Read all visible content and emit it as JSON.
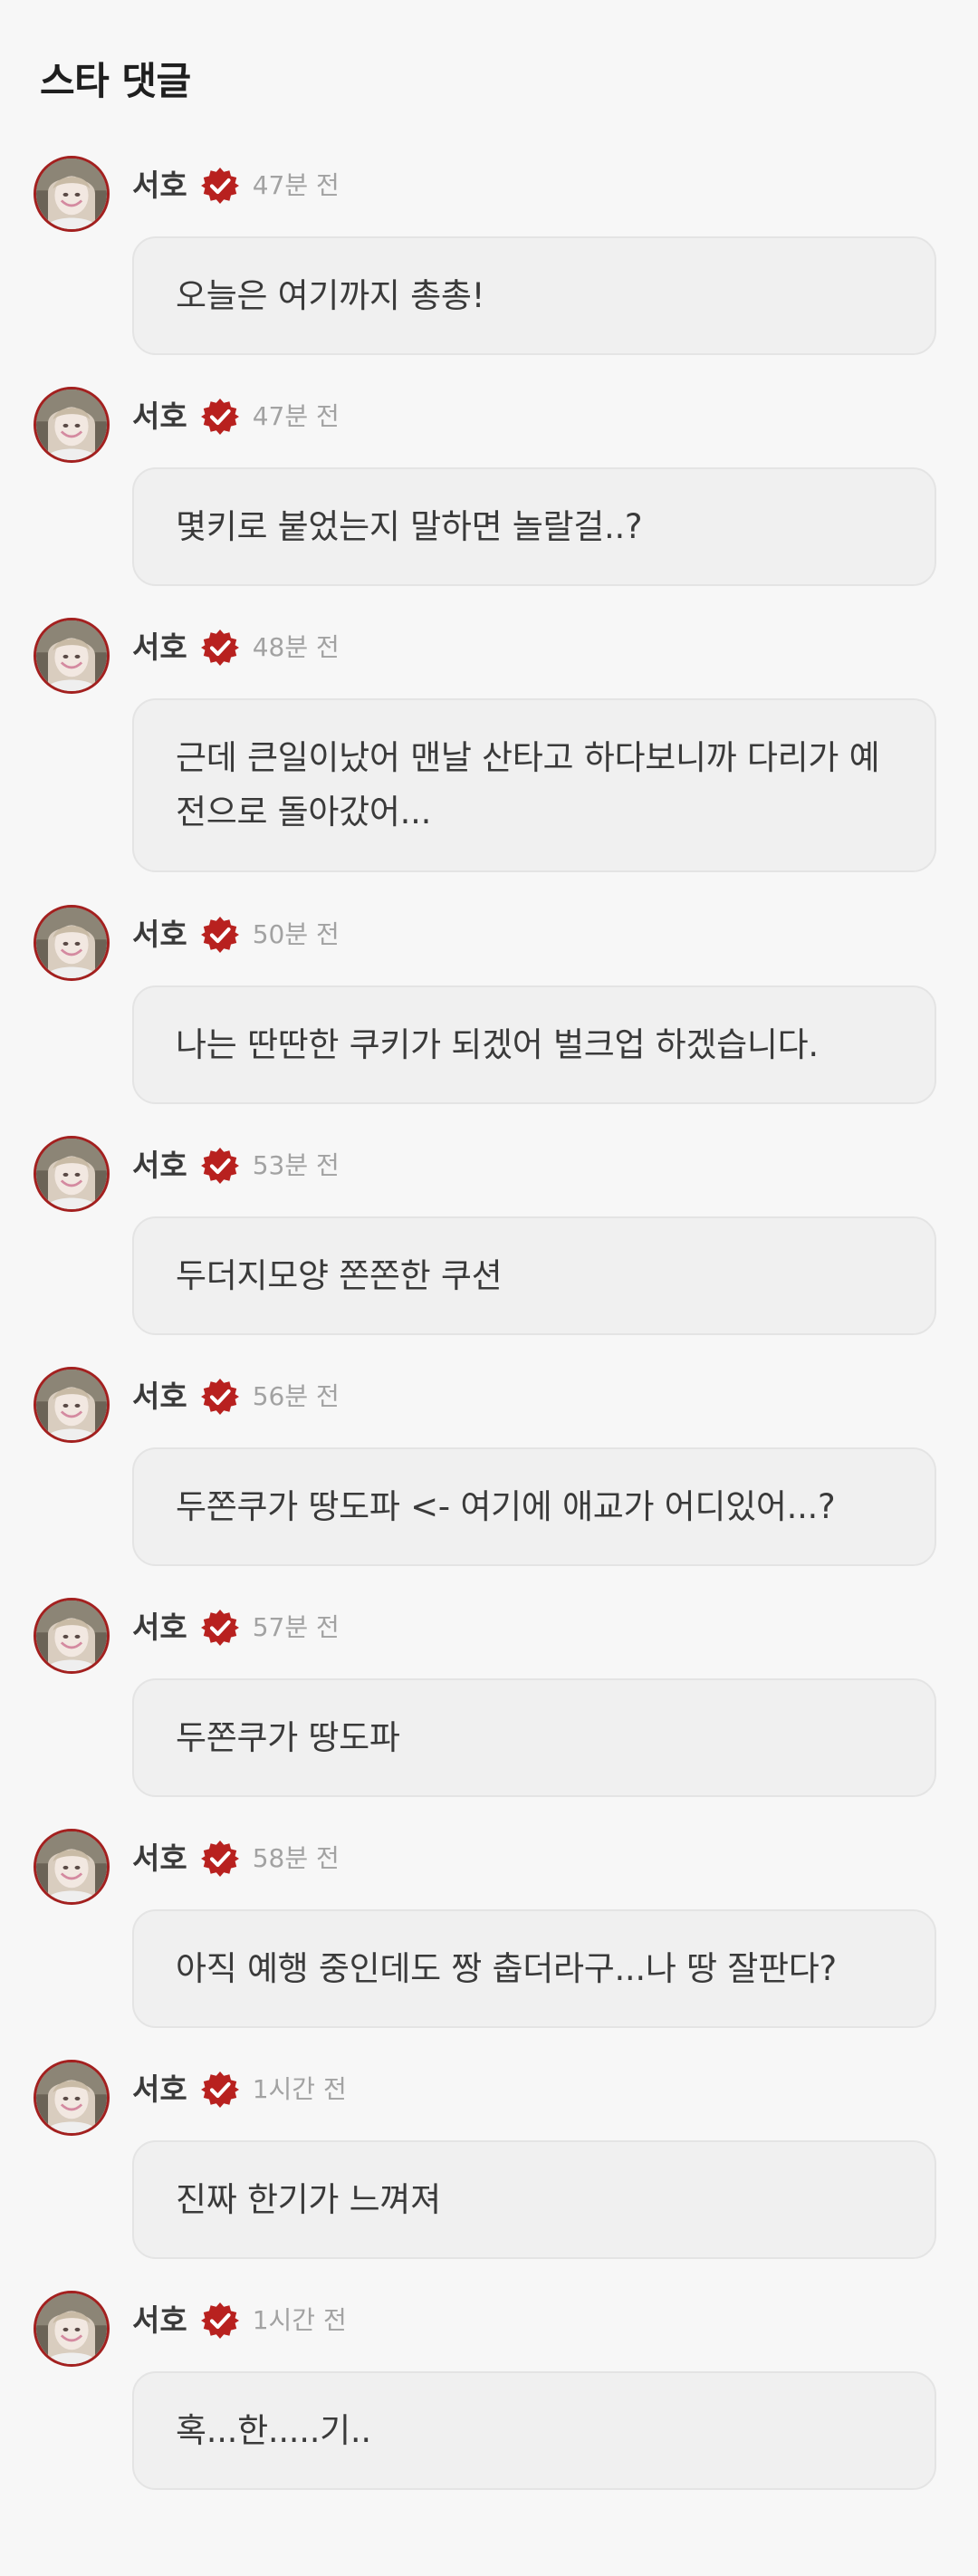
{
  "section": {
    "title": "스타 댓글"
  },
  "colors": {
    "background": "#f7f7f7",
    "bubble": "#f0f0f0",
    "bubble_border": "#e4e4e4",
    "badge": "#b8211f",
    "avatar_ring": "#a3201f",
    "name": "#3a3a3a",
    "time": "#a2a2a2"
  },
  "comments": [
    {
      "author": "서호",
      "verified_icon": "verified-badge-icon",
      "time": "47분 전",
      "text": "오늘은 여기까지 총총!"
    },
    {
      "author": "서호",
      "verified_icon": "verified-badge-icon",
      "time": "47분 전",
      "text": "몇키로 붙었는지 말하면 놀랄걸..?"
    },
    {
      "author": "서호",
      "verified_icon": "verified-badge-icon",
      "time": "48분 전",
      "text": "근데 큰일이났어 맨날 산타고 하다보니까 다리가 예전으로 돌아갔어..."
    },
    {
      "author": "서호",
      "verified_icon": "verified-badge-icon",
      "time": "50분 전",
      "text": "나는 딴딴한 쿠키가 되겠어 벌크업 하겠습니다."
    },
    {
      "author": "서호",
      "verified_icon": "verified-badge-icon",
      "time": "53분 전",
      "text": "두더지모양 쫀쫀한 쿠션"
    },
    {
      "author": "서호",
      "verified_icon": "verified-badge-icon",
      "time": "56분 전",
      "text": "두쫀쿠가 땅도파 <- 여기에 애교가 어디있어...?"
    },
    {
      "author": "서호",
      "verified_icon": "verified-badge-icon",
      "time": "57분 전",
      "text": "두쫀쿠가 땅도파"
    },
    {
      "author": "서호",
      "verified_icon": "verified-badge-icon",
      "time": "58분 전",
      "text": "아직 예행 중인데도 짱 춥더라구...나 땅 잘판다?"
    },
    {
      "author": "서호",
      "verified_icon": "verified-badge-icon",
      "time": "1시간 전",
      "text": "진짜 한기가 느껴져"
    },
    {
      "author": "서호",
      "verified_icon": "verified-badge-icon",
      "time": "1시간 전",
      "text": "혹...한.....기.."
    }
  ]
}
